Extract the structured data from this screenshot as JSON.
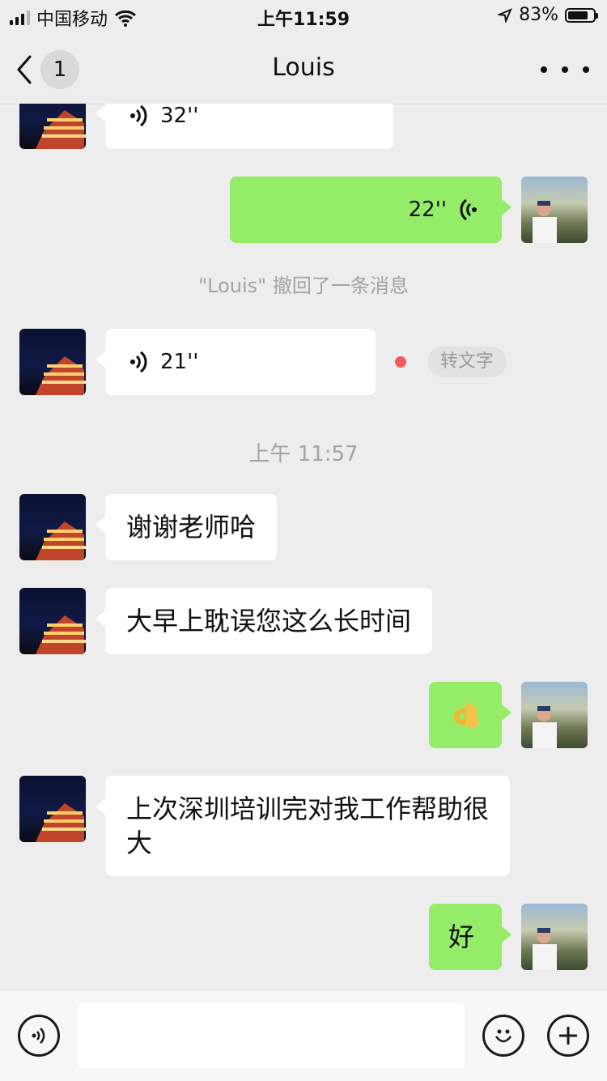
{
  "status_bar": {
    "carrier": "中国移动",
    "time": "上午11:59",
    "battery": "83%",
    "battery_level": 0.83
  },
  "nav": {
    "unread_count": "1",
    "title": "Louis"
  },
  "messages": [
    {
      "type": "voice",
      "side": "in",
      "duration": "32''"
    },
    {
      "type": "voice",
      "side": "out",
      "duration": "22''"
    },
    {
      "type": "system",
      "text": "\"Louis\" 撤回了一条消息"
    },
    {
      "type": "voice",
      "side": "in",
      "duration": "21''",
      "transcribe": "转文字"
    },
    {
      "type": "timestamp",
      "text": "上午 11:57"
    },
    {
      "type": "text",
      "side": "in",
      "text": "谢谢老师哈"
    },
    {
      "type": "text",
      "side": "in",
      "text": "大早上耽误您这么长时间"
    },
    {
      "type": "emoji",
      "side": "out",
      "text": "👌"
    },
    {
      "type": "text",
      "side": "in",
      "text": "上次深圳培训完对我工作帮助很大"
    },
    {
      "type": "text",
      "side": "out",
      "text": "好"
    }
  ],
  "input_bar": {
    "voice_icon": "voice-mode-icon",
    "emoji_icon": "emoji-icon",
    "plus_icon": "plus-icon"
  },
  "colors": {
    "background": "#ededed",
    "incoming_bubble": "#ffffff",
    "outgoing_bubble": "#95ec69",
    "unread_dot": "#f15b5b"
  }
}
